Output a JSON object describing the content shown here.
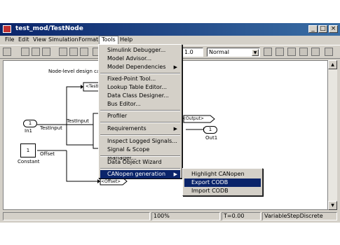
{
  "window": {
    "title": "test_mod/TestNode"
  },
  "menubar": [
    "File",
    "Edit",
    "View",
    "Simulation",
    "Format",
    "Tools",
    "Help"
  ],
  "toolbar": {
    "stop_time": "1.0",
    "sim_mode": "Normal"
  },
  "canvas": {
    "note": "Node-level design ca",
    "blocks": {
      "in1_num": "1",
      "in1_label": "In1",
      "const_val": "1",
      "const_label": "Constant",
      "out1_num": "1",
      "out1_label": "Out1"
    },
    "signals": {
      "testinput": "TestInput",
      "testinput2": "TestInput",
      "offset": "Offset",
      "goto1": "<TestInp",
      "goto2": "<Offset>",
      "output": "<Output>"
    }
  },
  "tools_menu": {
    "items": [
      "Simulink Debugger...",
      "Model Advisor...",
      "Model Dependencies",
      "Fixed-Point Tool...",
      "Lookup Table Editor...",
      "Data Class Designer...",
      "Bus Editor...",
      "Profiler",
      "Requirements",
      "Inspect Logged Signals...",
      "Signal & Scope Manager...",
      "Data Object Wizard",
      "CANopen generation"
    ]
  },
  "canopen_submenu": {
    "items": [
      "Highlight CANopen objects",
      "Export CODB",
      "Import CODB"
    ]
  },
  "status": {
    "zoom": "100%",
    "time": "T=0.00",
    "solver": "VariableStepDiscrete"
  },
  "colors": {
    "title_start": "#0a246a",
    "highlight": "#0a246a",
    "chrome": "#d4d0c8"
  }
}
